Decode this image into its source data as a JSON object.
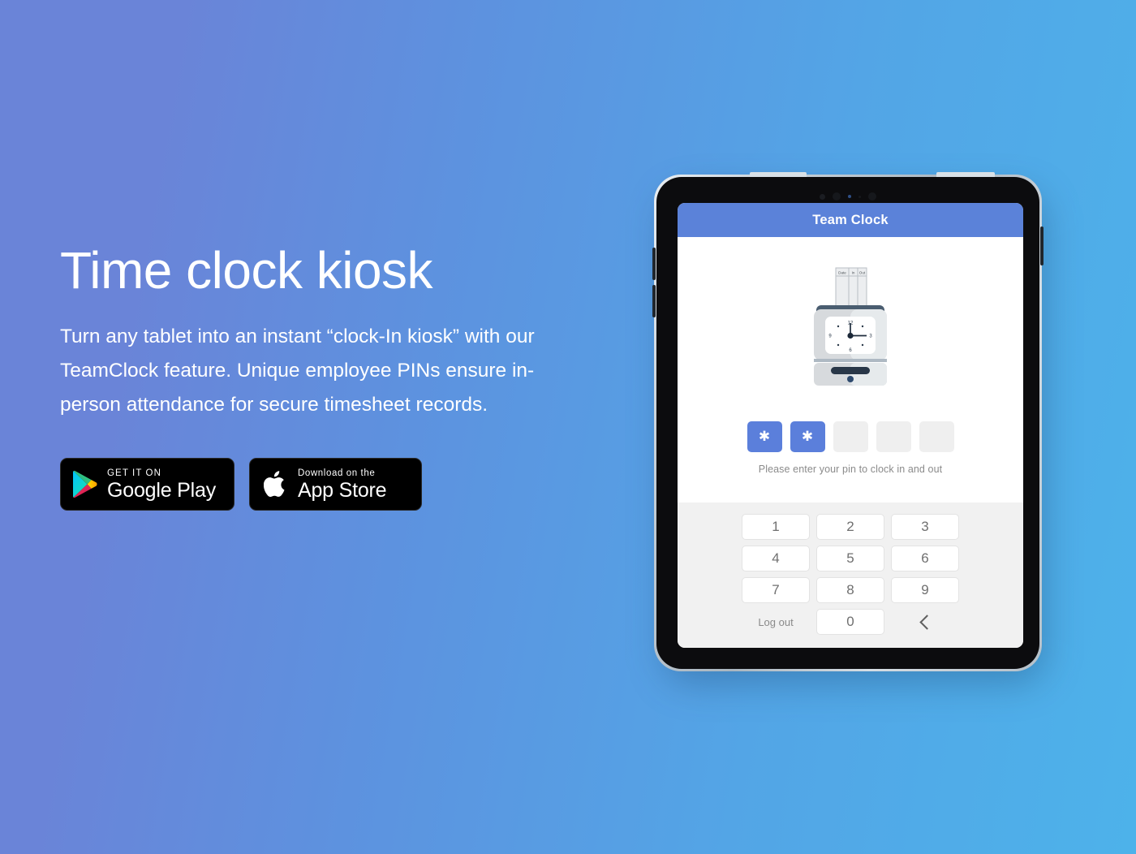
{
  "background": {
    "gradient_from": "#6a84d8",
    "gradient_to": "#4db2ea"
  },
  "marketing": {
    "headline": "Time clock kiosk",
    "subhead": "Turn any tablet into an instant “clock-In kiosk” with our TeamClock feature. Unique employee PINs ensure in-person attendance for secure timesheet records.",
    "badges": [
      {
        "id": "google-play",
        "small_label": "GET IT ON",
        "large_label": "Google Play",
        "icon": "google-play-icon"
      },
      {
        "id": "app-store",
        "small_label": "Download on the",
        "large_label": "App Store",
        "icon": "apple-logo-icon"
      }
    ]
  },
  "tablet": {
    "app": {
      "header_title": "Team Clock",
      "header_color": "#5b82d9",
      "illustration": {
        "name": "punch-clock-illustration",
        "timecard_columns": [
          "Date",
          "In",
          "Out"
        ],
        "clock_numerals": [
          "12",
          "3",
          "6",
          "9"
        ],
        "clock_time": "3:00"
      },
      "pin": {
        "length": 5,
        "filled_count": 2,
        "mask_character": "✱",
        "filled_color": "#5b7fdb",
        "empty_color": "#efefef",
        "hint": "Please enter your pin to clock in and out"
      },
      "keypad": {
        "rows": [
          [
            "1",
            "2",
            "3"
          ],
          [
            "4",
            "5",
            "6"
          ],
          [
            "7",
            "8",
            "9"
          ]
        ],
        "logout_label": "Log out",
        "zero_label": "0",
        "backspace_icon": "chevron-left-icon"
      }
    }
  }
}
